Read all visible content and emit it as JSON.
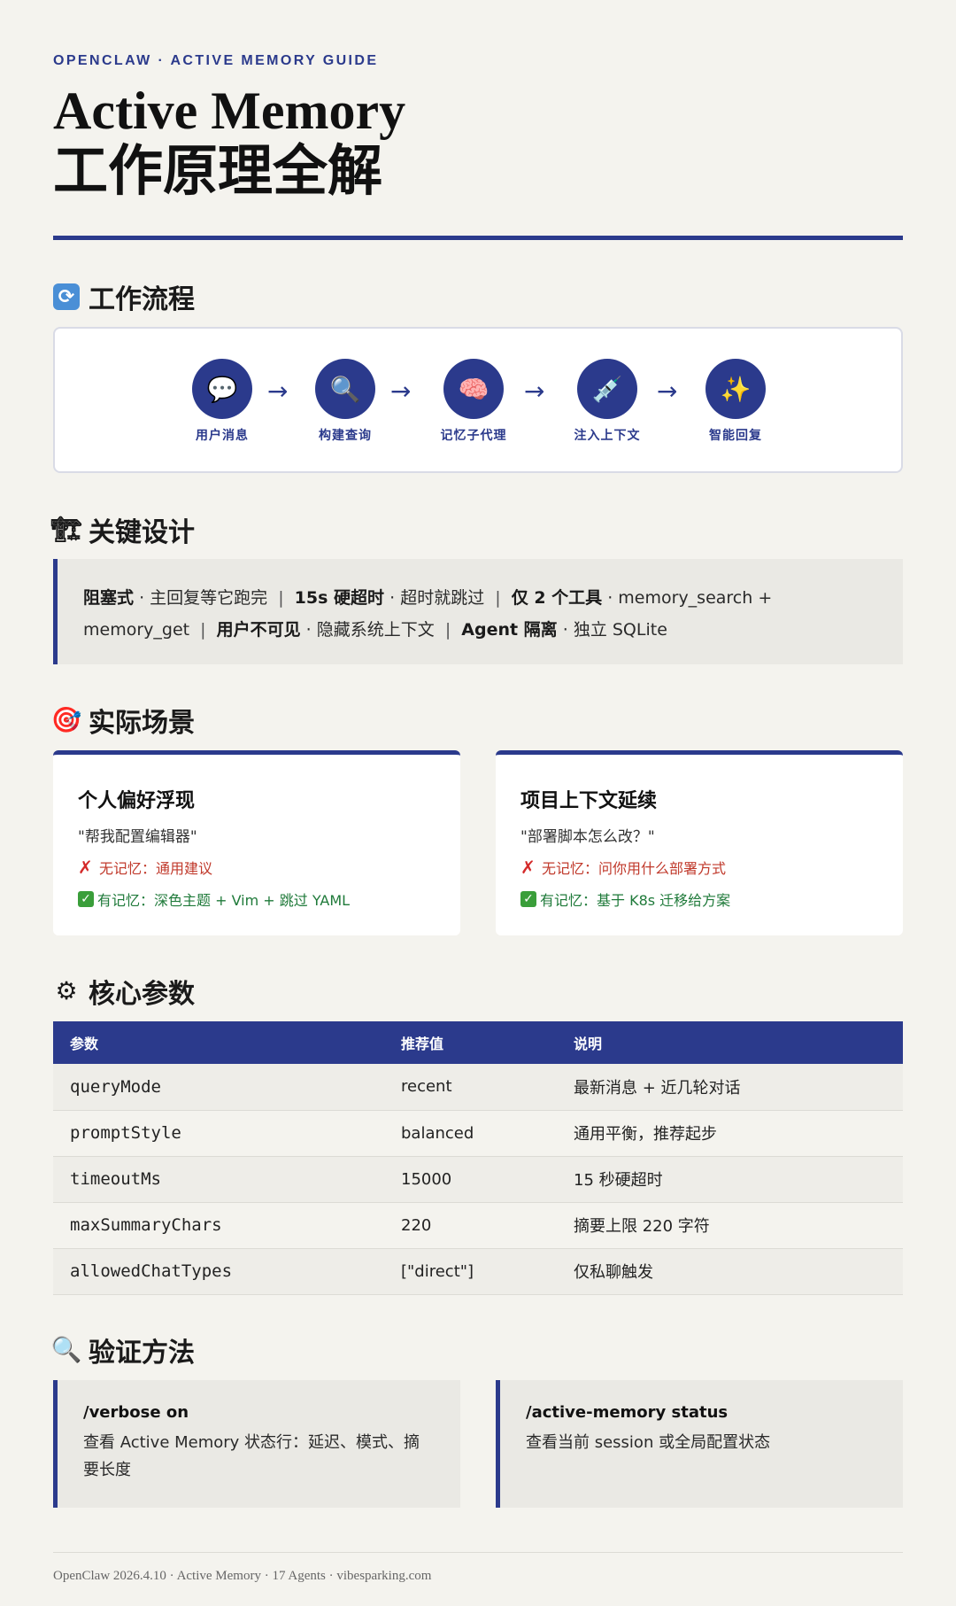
{
  "header": {
    "kicker": "OPENCLAW · ACTIVE MEMORY GUIDE",
    "title_en": "Active Memory",
    "title_zh": "工作原理全解"
  },
  "sections": {
    "flow": {
      "title": "工作流程",
      "icon": "refresh-icon"
    },
    "design": {
      "title": "关键设计",
      "icon": "crane-icon"
    },
    "scenarios": {
      "title": "实际场景",
      "icon": "target-icon"
    },
    "params": {
      "title": "核心参数",
      "icon": "gear-icon"
    },
    "verify": {
      "title": "验证方法",
      "icon": "magnifier-icon"
    }
  },
  "flow": {
    "steps": [
      {
        "label": "用户消息",
        "icon": "speech-bubble-icon",
        "glyph": "💬"
      },
      {
        "label": "构建查询",
        "icon": "magnifier-icon",
        "glyph": "🔍"
      },
      {
        "label": "记忆子代理",
        "icon": "brain-icon",
        "glyph": "🧠"
      },
      {
        "label": "注入上下文",
        "icon": "syringe-icon",
        "glyph": "💉"
      },
      {
        "label": "智能回复",
        "icon": "sparkles-icon",
        "glyph": "✨"
      }
    ],
    "arrow": "→"
  },
  "design": {
    "items": [
      {
        "bold": "阻塞式",
        "text": "主回复等它跑完"
      },
      {
        "bold": "15s 硬超时",
        "text": "超时就跳过"
      },
      {
        "bold": "仅 2 个工具",
        "text": "memory_search + memory_get"
      },
      {
        "bold": "用户不可见",
        "text": "隐藏系统上下文"
      },
      {
        "bold": "Agent 隔离",
        "text": "独立 SQLite"
      }
    ],
    "dot": "·",
    "separator": "|"
  },
  "scenarios": [
    {
      "title": "个人偏好浮现",
      "quote": "\"帮我配置编辑器\"",
      "without": "无记忆：通用建议",
      "with": "有记忆：深色主题 + Vim + 跳过 YAML"
    },
    {
      "title": "项目上下文延续",
      "quote": "\"部署脚本怎么改？\"",
      "without": "无记忆：问你用什么部署方式",
      "with": "有记忆：基于 K8s 迁移给方案"
    }
  ],
  "params_table": {
    "headers": [
      "参数",
      "推荐值",
      "说明"
    ],
    "rows": [
      [
        "queryMode",
        "recent",
        "最新消息 + 近几轮对话"
      ],
      [
        "promptStyle",
        "balanced",
        "通用平衡，推荐起步"
      ],
      [
        "timeoutMs",
        "15000",
        "15 秒硬超时"
      ],
      [
        "maxSummaryChars",
        "220",
        "摘要上限 220 字符"
      ],
      [
        "allowedChatTypes",
        "[\"direct\"]",
        "仅私聊触发"
      ]
    ]
  },
  "verify": [
    {
      "command": "/verbose on",
      "desc": "查看 Active Memory 状态行：延迟、模式、摘要长度"
    },
    {
      "command": "/active-memory status",
      "desc": "查看当前 session 或全局配置状态"
    }
  ],
  "footer": "OpenClaw 2026.4.10 · Active Memory · 17 Agents · vibesparking.com",
  "colors": {
    "accent": "#2b3a8c",
    "background": "#f4f3ee",
    "no": "#c0392b",
    "yes": "#1f7a3a"
  }
}
